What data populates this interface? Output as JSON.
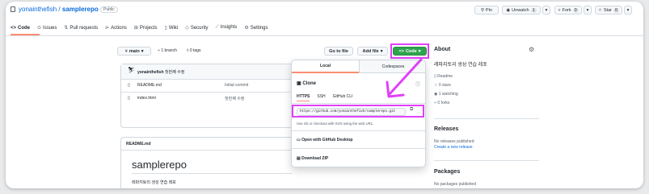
{
  "repo": {
    "owner": "yonainthefish",
    "separator": "/",
    "name": "samplerepo",
    "visibility": "Public"
  },
  "header_actions": {
    "pin": "Pin",
    "unwatch": "Unwatch",
    "unwatch_count": "1",
    "fork": "Fork",
    "fork_count": "0",
    "star": "Star",
    "star_count": "0"
  },
  "tabs": [
    "Code",
    "Issues",
    "Pull requests",
    "Actions",
    "Projects",
    "Wiki",
    "Security",
    "Insights",
    "Settings"
  ],
  "toolbar": {
    "branch": "main",
    "branches": "1 branch",
    "tags": "0 tags",
    "go_to_file": "Go to file",
    "add_file": "Add file",
    "code": "Code"
  },
  "commit": {
    "author": "yonainthefish",
    "message": "첫번째 수정"
  },
  "files": [
    {
      "name": "README.md",
      "commit": "Initial commit"
    },
    {
      "name": "index.html",
      "commit": "첫번째 수정"
    }
  ],
  "readme": {
    "label": "README.md",
    "title": "samplerepo",
    "body": "레파지토리 생성 연습 레포"
  },
  "about": {
    "heading": "About",
    "description": "레파지토리 생성 연습 레포",
    "readme": "Readme",
    "stars": "0 stars",
    "watching": "1 watching",
    "forks": "0 forks"
  },
  "releases": {
    "heading": "Releases",
    "none": "No releases published",
    "create": "Create a new release"
  },
  "packages": {
    "heading": "Packages",
    "none": "No packages published"
  },
  "clone_menu": {
    "tab_local": "Local",
    "tab_codespaces": "Codespaces",
    "clone": "Clone",
    "protocols": [
      "HTTPS",
      "SSH",
      "GitHub CLI"
    ],
    "url": "https://github.com/yonainthefish/samplerepo.git",
    "hint": "Use Git or checkout with SVN using the web URL.",
    "desktop": "Open with GitHub Desktop",
    "zip": "Download ZIP"
  },
  "colors": {
    "accent": "#e040fb",
    "green": "#2da44e",
    "link": "#0969da",
    "tab_underline": "#fd8c73"
  }
}
